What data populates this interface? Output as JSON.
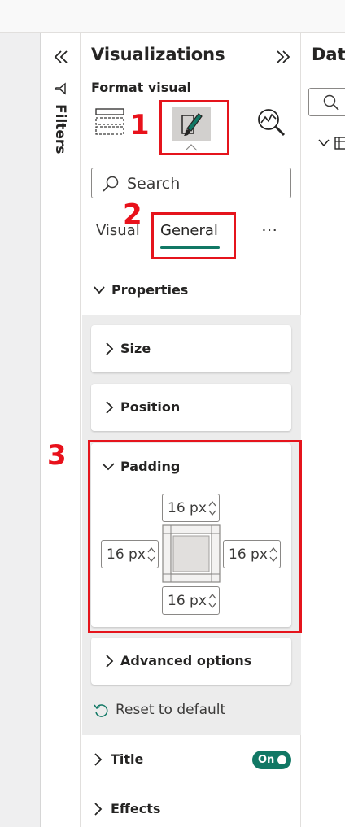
{
  "filters": {
    "title": "Filters"
  },
  "visualizations": {
    "title": "Visualizations",
    "format_label": "Format visual",
    "search_placeholder": "Search",
    "tabs": [
      {
        "label": "Visual",
        "selected": false
      },
      {
        "label": "General",
        "selected": true
      }
    ],
    "more_label": "⋯",
    "properties": {
      "label": "Properties",
      "cards": {
        "size": "Size",
        "position": "Position",
        "padding": "Padding",
        "advanced": "Advanced options"
      },
      "padding": {
        "top": "16 px",
        "left": "16 px",
        "right": "16 px",
        "bottom": "16 px"
      },
      "reset_label": "Reset to default"
    },
    "title_section": {
      "label": "Title",
      "toggle": "On"
    },
    "effects_section": {
      "label": "Effects"
    }
  },
  "annotations": {
    "step1": "1",
    "step2": "2",
    "step3": "3"
  },
  "data_pane": {
    "title": "Data"
  },
  "colors": {
    "accent": "#117865",
    "annotation_red": "#e5141c",
    "panel_gray": "#ececec"
  }
}
